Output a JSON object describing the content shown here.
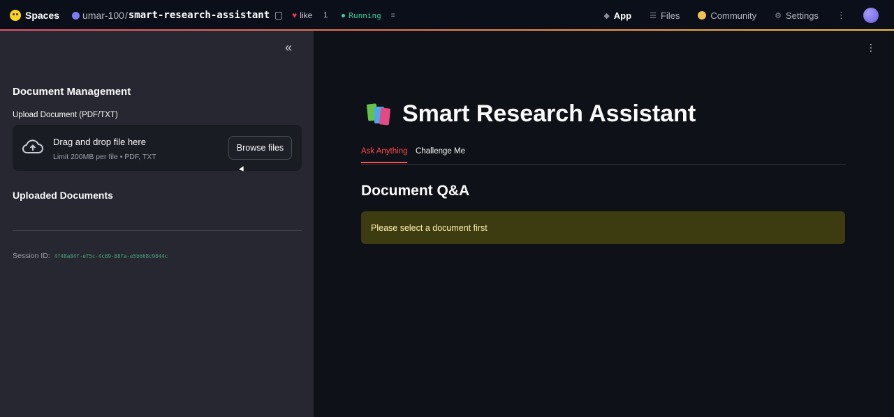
{
  "topbar": {
    "brand": "Spaces",
    "repo_owner": "umar-100",
    "repo_separator": "/",
    "repo_name": "smart-research-assistant",
    "like_label": "like",
    "like_count": "1",
    "status": "Running",
    "nav": [
      {
        "label": "App",
        "icon": "cube-icon",
        "active": true
      },
      {
        "label": "Files",
        "icon": "files-icon",
        "active": false
      },
      {
        "label": "Community",
        "icon": "community-icon",
        "active": false
      },
      {
        "label": "Settings",
        "icon": "gear-icon",
        "active": false
      }
    ]
  },
  "sidebar": {
    "heading": "Document Management",
    "upload_label": "Upload Document (PDF/TXT)",
    "dropzone": {
      "title": "Drag and drop file here",
      "limit": "Limit 200MB per file • PDF, TXT",
      "browse_label": "Browse files"
    },
    "uploaded_heading": "Uploaded Documents",
    "session_label": "Session ID:",
    "session_id": "4f48a84f-ef5c-4c89-88fa-e5b668c9844c"
  },
  "main": {
    "title": "Smart Research Assistant",
    "tabs": [
      {
        "label": "Ask Anything",
        "active": true
      },
      {
        "label": "Challenge Me",
        "active": false
      }
    ],
    "section_title": "Document Q&A",
    "alert": "Please select a document first"
  },
  "colors": {
    "accent": "#ff4b4b",
    "running": "#34d399",
    "alert_bg": "#3d3b10"
  }
}
